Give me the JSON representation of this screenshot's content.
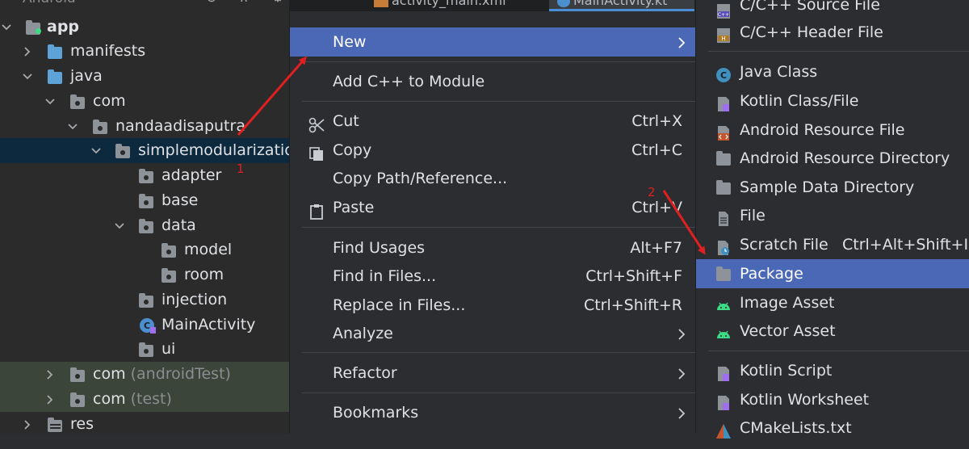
{
  "tree": {
    "header": "Android",
    "rows": [
      {
        "label": "app",
        "sub": ""
      },
      {
        "label": "manifests",
        "sub": ""
      },
      {
        "label": "java",
        "sub": ""
      },
      {
        "label": "com",
        "sub": ""
      },
      {
        "label": "nandaadisaputra",
        "sub": ""
      },
      {
        "label": "simplemodularization",
        "sub": ""
      },
      {
        "label": "adapter",
        "sub": ""
      },
      {
        "label": "base",
        "sub": ""
      },
      {
        "label": "data",
        "sub": ""
      },
      {
        "label": "model",
        "sub": ""
      },
      {
        "label": "room",
        "sub": ""
      },
      {
        "label": "injection",
        "sub": ""
      },
      {
        "label": "MainActivity",
        "sub": ""
      },
      {
        "label": "ui",
        "sub": ""
      },
      {
        "label": "com",
        "sub": "(androidTest)"
      },
      {
        "label": "com",
        "sub": "(test)"
      },
      {
        "label": "res",
        "sub": ""
      }
    ],
    "marker": "1"
  },
  "tabs": [
    "activity_main.xml",
    "MainActivity.kt"
  ],
  "context_menu": {
    "items": [
      {
        "label": "New",
        "shortcut": "",
        "submenu": true
      },
      {
        "label": "Add C++ to Module",
        "shortcut": ""
      },
      {
        "label": "Cut",
        "shortcut": "Ctrl+X",
        "icon": "scissors-icon"
      },
      {
        "label": "Copy",
        "shortcut": "Ctrl+C",
        "icon": "copy-icon"
      },
      {
        "label": "Copy Path/Reference...",
        "shortcut": ""
      },
      {
        "label": "Paste",
        "shortcut": "Ctrl+V",
        "icon": "clipboard-icon"
      },
      {
        "label": "Find Usages",
        "shortcut": "Alt+F7"
      },
      {
        "label": "Find in Files...",
        "shortcut": "Ctrl+Shift+F"
      },
      {
        "label": "Replace in Files...",
        "shortcut": "Ctrl+Shift+R"
      },
      {
        "label": "Analyze",
        "shortcut": "",
        "submenu": true
      },
      {
        "label": "Refactor",
        "shortcut": "",
        "submenu": true
      },
      {
        "label": "Bookmarks",
        "shortcut": "",
        "submenu": true
      }
    ],
    "marker": "2"
  },
  "submenu": {
    "items": [
      {
        "label": "C/C++ Source File",
        "shortcut": "",
        "icon": "cpp-source-icon"
      },
      {
        "label": "C/C++ Header File",
        "shortcut": "",
        "icon": "cpp-header-icon"
      },
      {
        "label": "Java Class",
        "shortcut": "",
        "icon": "java-class-icon"
      },
      {
        "label": "Kotlin Class/File",
        "shortcut": "",
        "icon": "kotlin-file-icon"
      },
      {
        "label": "Android Resource File",
        "shortcut": "",
        "icon": "android-resource-file-icon"
      },
      {
        "label": "Android Resource Directory",
        "shortcut": "",
        "icon": "folder-icon"
      },
      {
        "label": "Sample Data Directory",
        "shortcut": "",
        "icon": "folder-icon"
      },
      {
        "label": "File",
        "shortcut": "",
        "icon": "file-icon"
      },
      {
        "label": "Scratch File",
        "shortcut": "Ctrl+Alt+Shift+Ins",
        "icon": "scratch-file-icon"
      },
      {
        "label": "Package",
        "shortcut": "",
        "icon": "package-folder-icon"
      },
      {
        "label": "Image Asset",
        "shortcut": "",
        "icon": "android-icon"
      },
      {
        "label": "Vector Asset",
        "shortcut": "",
        "icon": "android-icon"
      },
      {
        "label": "Kotlin Script",
        "shortcut": "",
        "icon": "kotlin-script-icon"
      },
      {
        "label": "Kotlin Worksheet",
        "shortcut": "",
        "icon": "kotlin-worksheet-icon"
      },
      {
        "label": "CMakeLists.txt",
        "shortcut": "",
        "icon": "cmake-icon"
      }
    ]
  },
  "colors": {
    "highlight": "#4a68b5",
    "selection": "#0d293e",
    "annotation": "#e02020"
  }
}
